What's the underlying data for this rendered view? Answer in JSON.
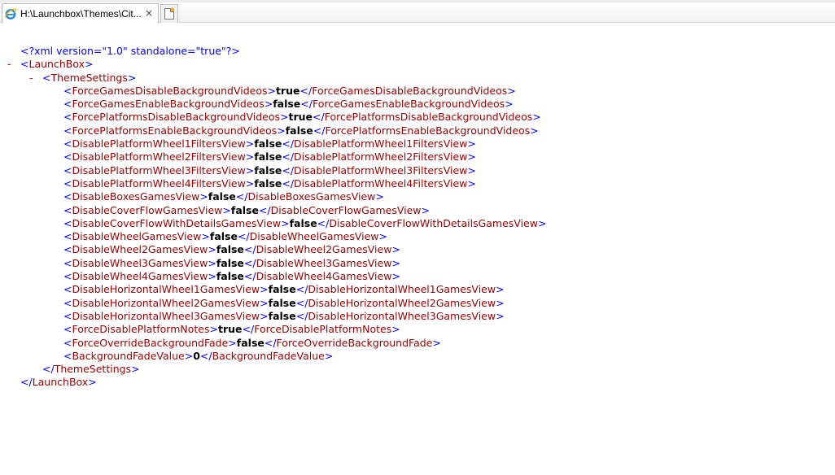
{
  "tab": {
    "title": "H:\\Launchbox\\Themes\\Cit...",
    "close": "×"
  },
  "xml": {
    "declaration_text": "xml version=\"1.0\" standalone=\"true\"",
    "toggle_symbol": "-",
    "root_name": "LaunchBox",
    "group_name": "ThemeSettings",
    "settings": [
      {
        "name": "ForceGamesDisableBackgroundVideos",
        "value": "true"
      },
      {
        "name": "ForceGamesEnableBackgroundVideos",
        "value": "false"
      },
      {
        "name": "ForcePlatformsDisableBackgroundVideos",
        "value": "true"
      },
      {
        "name": "ForcePlatformsEnableBackgroundVideos",
        "value": "false"
      },
      {
        "name": "DisablePlatformWheel1FiltersView",
        "value": "false"
      },
      {
        "name": "DisablePlatformWheel2FiltersView",
        "value": "false"
      },
      {
        "name": "DisablePlatformWheel3FiltersView",
        "value": "false"
      },
      {
        "name": "DisablePlatformWheel4FiltersView",
        "value": "false"
      },
      {
        "name": "DisableBoxesGamesView",
        "value": "false"
      },
      {
        "name": "DisableCoverFlowGamesView",
        "value": "false"
      },
      {
        "name": "DisableCoverFlowWithDetailsGamesView",
        "value": "false"
      },
      {
        "name": "DisableWheelGamesView",
        "value": "false"
      },
      {
        "name": "DisableWheel2GamesView",
        "value": "false"
      },
      {
        "name": "DisableWheel3GamesView",
        "value": "false"
      },
      {
        "name": "DisableWheel4GamesView",
        "value": "false"
      },
      {
        "name": "DisableHorizontalWheel1GamesView",
        "value": "false"
      },
      {
        "name": "DisableHorizontalWheel2GamesView",
        "value": "false"
      },
      {
        "name": "DisableHorizontalWheel3GamesView",
        "value": "false"
      },
      {
        "name": "ForceDisablePlatformNotes",
        "value": "true"
      },
      {
        "name": "ForceOverrideBackgroundFade",
        "value": "false"
      },
      {
        "name": "BackgroundFadeValue",
        "value": "0"
      }
    ]
  },
  "colors": {
    "markup": "#0000ff",
    "tag_name": "#990000",
    "value": "#000000",
    "toggle": "#ff0000"
  }
}
